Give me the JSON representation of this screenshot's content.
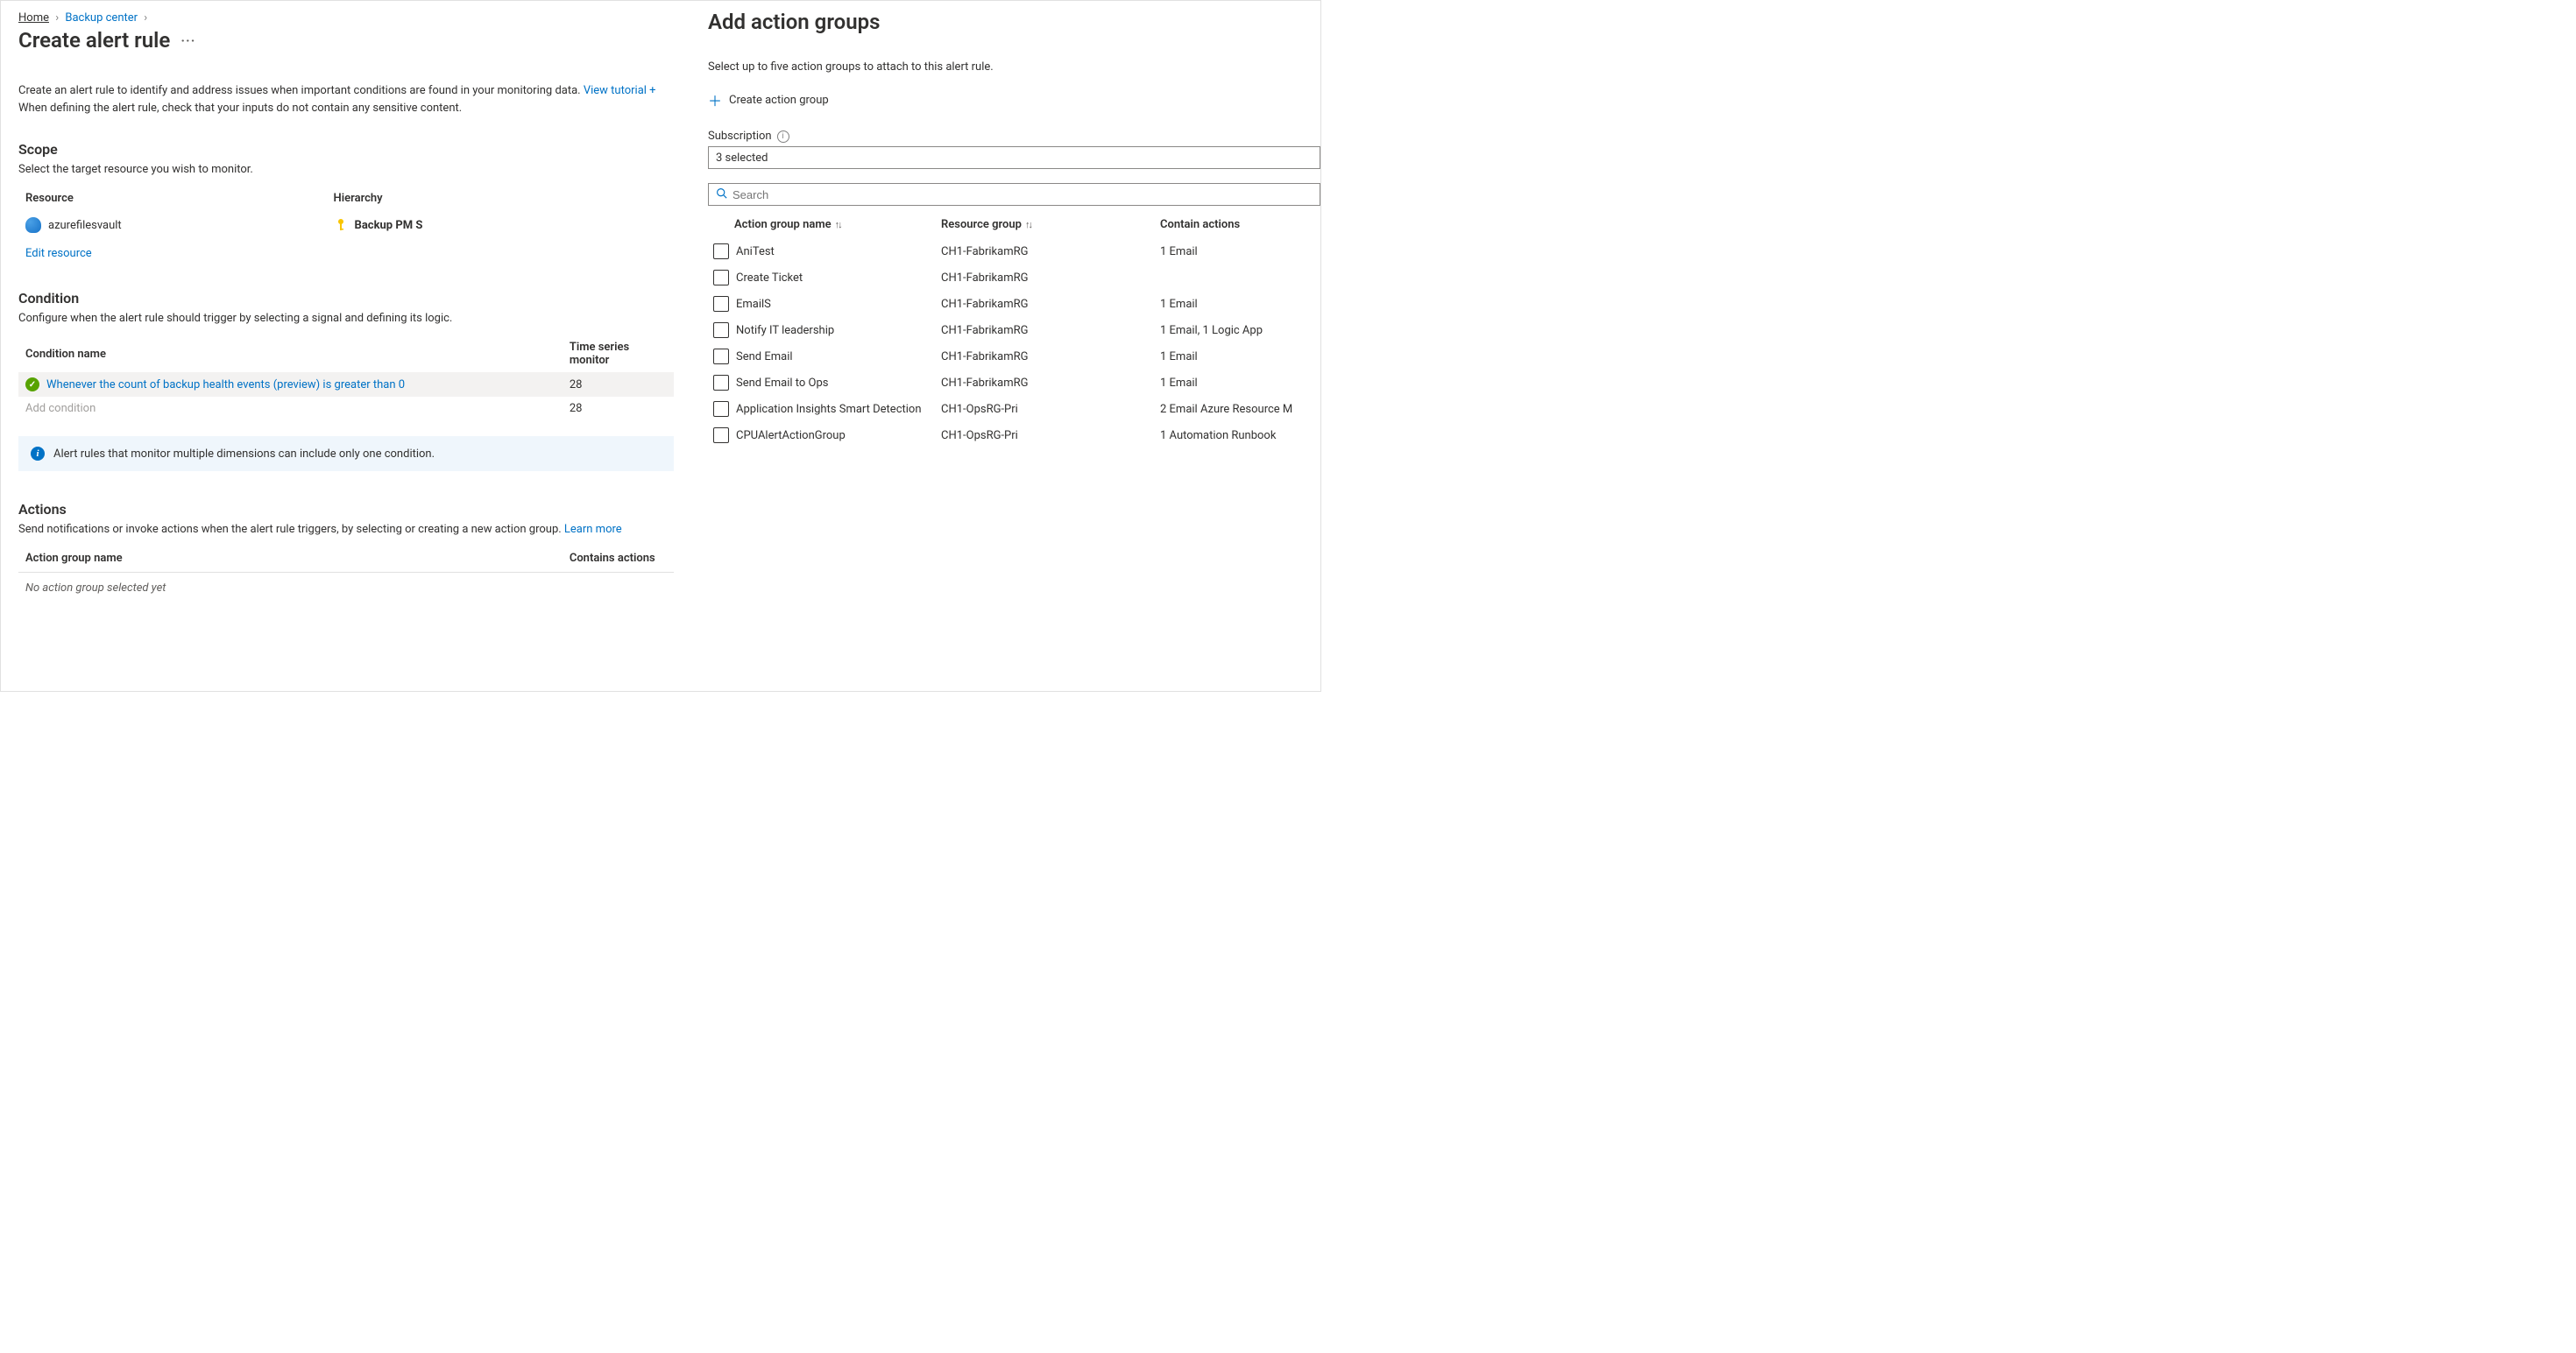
{
  "breadcrumb": {
    "home": "Home",
    "backup": "Backup center"
  },
  "page_title": "Create alert rule",
  "intro": {
    "line1_prefix": "Create an alert rule to identify and address issues when important conditions are found in your monitoring data. ",
    "tutorial_link": "View tutorial +",
    "line2": "When defining the alert rule, check that your inputs do not contain any sensitive content."
  },
  "scope": {
    "title": "Scope",
    "sub": "Select the target resource you wish to monitor.",
    "col_resource": "Resource",
    "col_hierarchy": "Hierarchy",
    "resource_name": "azurefilesvault",
    "hierarchy_value": "Backup PM S",
    "edit_link": "Edit resource"
  },
  "condition": {
    "title": "Condition",
    "sub": "Configure when the alert rule should trigger by selecting a signal and defining its logic.",
    "col_name": "Condition name",
    "col_ts": "Time series monitor",
    "row1_name": "Whenever the count of backup health events (preview) is greater than 0",
    "row1_ts": "28",
    "row2_name": "Add condition",
    "row2_ts": "28",
    "info_text": "Alert rules that monitor multiple dimensions can include only one condition."
  },
  "actions": {
    "title": "Actions",
    "sub_prefix": "Send notifications or invoke actions when the alert rule triggers, by selecting or creating a new action group. ",
    "learn_more": "Learn more",
    "col_name": "Action group name",
    "col_contains": "Contains actions",
    "none_row": "No action group selected yet"
  },
  "panel": {
    "title": "Add action groups",
    "sub": "Select up to five action groups to attach to this alert rule.",
    "create_link": "Create action group",
    "subscription_label": "Subscription",
    "subscription_value": "3 selected",
    "search_placeholder": "Search",
    "col_name": "Action group name",
    "col_rg": "Resource group",
    "col_actions": "Contain actions",
    "rows": [
      {
        "name": "AniTest",
        "rg": "CH1-FabrikamRG",
        "act": "1 Email"
      },
      {
        "name": "Create Ticket",
        "rg": "CH1-FabrikamRG",
        "act": ""
      },
      {
        "name": "EmailS",
        "rg": "CH1-FabrikamRG",
        "act": "1 Email"
      },
      {
        "name": "Notify IT leadership",
        "rg": "CH1-FabrikamRG",
        "act": "1 Email, 1 Logic App"
      },
      {
        "name": "Send Email",
        "rg": "CH1-FabrikamRG",
        "act": "1 Email"
      },
      {
        "name": "Send Email to Ops",
        "rg": "CH1-FabrikamRG",
        "act": "1 Email"
      },
      {
        "name": "Application Insights Smart Detection",
        "rg": "CH1-OpsRG-Pri",
        "act": "2 Email Azure Resource M"
      },
      {
        "name": "CPUAlertActionGroup",
        "rg": "CH1-OpsRG-Pri",
        "act": "1 Automation Runbook"
      }
    ]
  }
}
